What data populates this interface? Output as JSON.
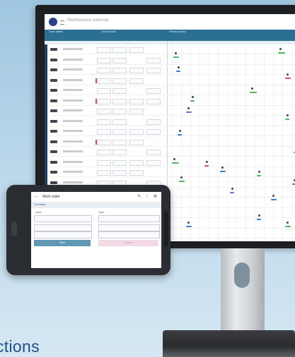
{
  "monitor": {
    "app_title": "Maintenance calendar",
    "header_groups": [
      "Truck details",
      "Job schedule",
      "Planned weeks"
    ],
    "rows": 19
  },
  "tablet": {
    "screen_title": "Work order",
    "banner_label": "Job details",
    "fields": {
      "left_label": "Asset",
      "right_label": "Type"
    },
    "buttons": {
      "primary": "Save",
      "secondary": "Cancel"
    }
  },
  "caption": "ctions",
  "colors": {
    "header_blue": "#2c6f95",
    "caption_blue": "#1d4f8a",
    "flag_red": "#e24a5a",
    "bar_green": "#4dbb57"
  }
}
